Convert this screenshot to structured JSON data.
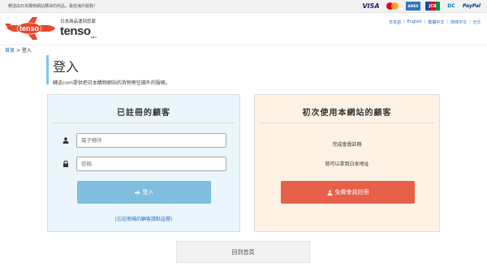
{
  "topbar": {
    "notice": "轉送由日本購物網站購得的商品，最佳海外服務！",
    "payment": {
      "visa": "VISA",
      "amex": "AMEX",
      "jcb": "JCB",
      "diners": "DC",
      "paypal": "PayPal"
    }
  },
  "header": {
    "logo_word": "tenso",
    "tagline": "日本商品運到您家",
    "brand": "tenso",
    "brand_suffix": ".com",
    "languages": [
      "日本語",
      "English",
      "繁體中文",
      "简体中文",
      "한국"
    ]
  },
  "breadcrumb": {
    "home": "首頁",
    "separator": ">",
    "current": "登入"
  },
  "page": {
    "title": "登入",
    "subtitle": "轉送com提供把日本購物網站的貨物寄往國外的服務。"
  },
  "registered": {
    "heading": "已註冊的顧客",
    "email_placeholder": "電子郵件",
    "password_placeholder": "密碼",
    "login_label": "登入",
    "forgot_link": "(忘記密碼的顧客請點這裡)"
  },
  "newcustomer": {
    "heading": "初次使用本網站的顧客",
    "line1": "完成會員註冊",
    "line2": "就可以拿到日本地址",
    "register_label": "免費會員註冊"
  },
  "footer": {
    "home_button": "回到首頁"
  },
  "colors": {
    "accent_blue": "#7fbedf",
    "register_red": "#e85f4a",
    "logo_red": "#e8472e",
    "link_blue": "#2a6ebb"
  }
}
